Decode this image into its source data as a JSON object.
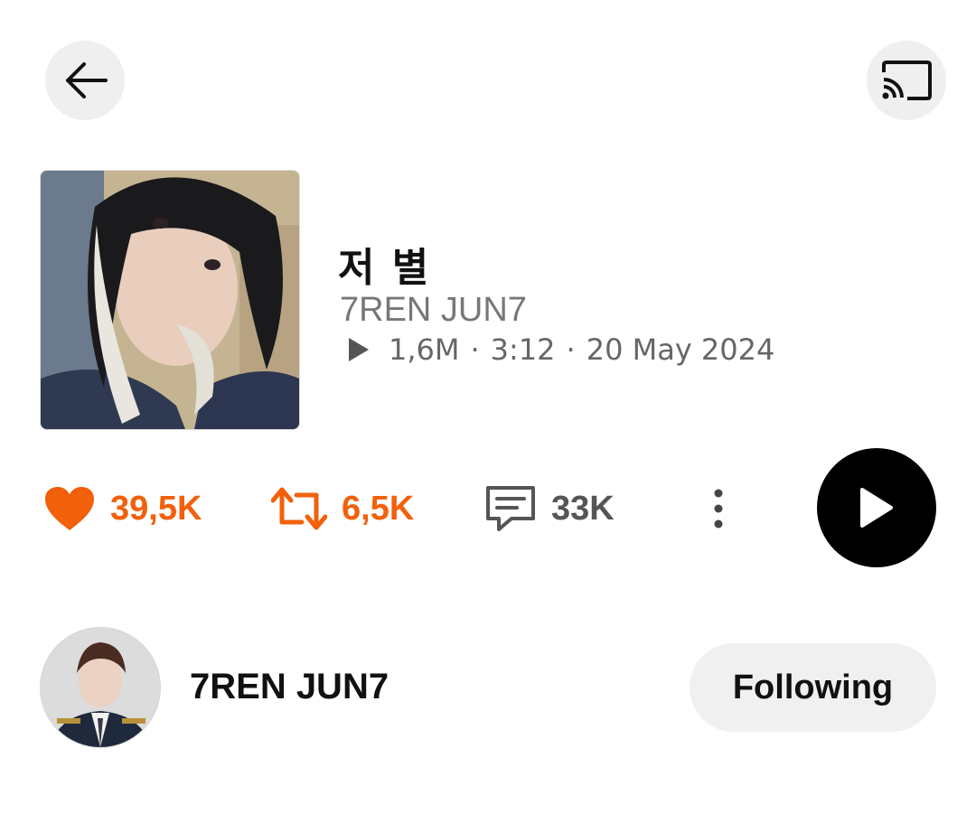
{
  "header": {
    "back_icon": "arrow-left-icon",
    "cast_icon": "cast-icon"
  },
  "track": {
    "title": "저 별",
    "artist": "7REN JUN7",
    "plays": "1,6M",
    "duration": "3:12",
    "date": "20 May 2024",
    "separator": "·"
  },
  "stats": {
    "likes": "39,5K",
    "reposts": "6,5K",
    "comments": "33K"
  },
  "user": {
    "name": "7REN JUN7",
    "follow_label": "Following"
  },
  "colors": {
    "accent": "#f2600c",
    "play_button": "#000000",
    "button_bg": "#efefef"
  }
}
